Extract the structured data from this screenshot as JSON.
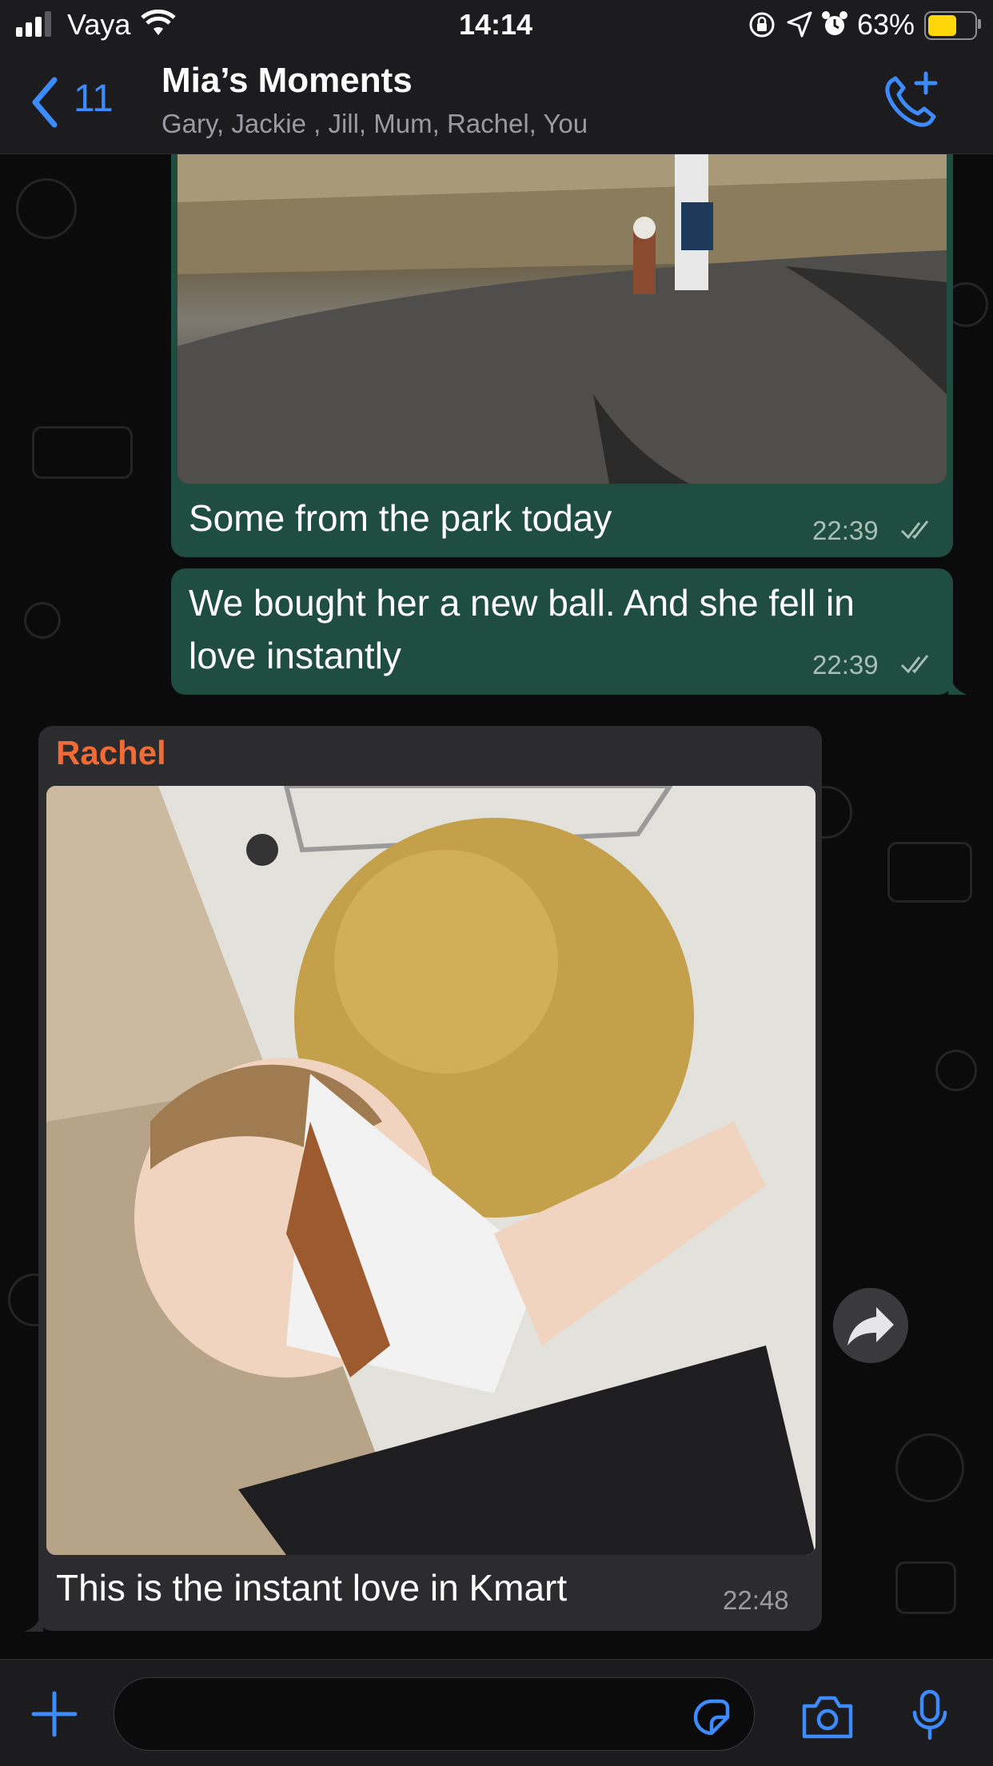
{
  "status_bar": {
    "carrier": "Vaya",
    "time": "14:14",
    "battery_percent": "63%",
    "battery_level": 0.63,
    "battery_color": "#ffd60a"
  },
  "header": {
    "back_count": "11",
    "title": "Mia’s Moments",
    "participants": "Gary, Jackie , Jill, Mum, Rachel, You",
    "accent_color": "#3d8bfd"
  },
  "messages": [
    {
      "direction": "outgoing",
      "type": "image",
      "caption": "Some from the park today",
      "time": "22:39",
      "status": "read"
    },
    {
      "direction": "outgoing",
      "type": "text",
      "text_line1": "We bought her a new ball. And she fell in",
      "text_line2": "love instantly",
      "time": "22:39",
      "status": "read"
    },
    {
      "direction": "incoming",
      "type": "image",
      "sender": "Rachel",
      "sender_color": "#f06b35",
      "caption": "This is the instant love in Kmart",
      "time": "22:48"
    }
  ],
  "icons": {
    "back": "chevron-left-icon",
    "call": "add-call-icon",
    "forward": "forward-icon",
    "attach": "plus-icon",
    "sticker": "sticker-icon",
    "camera": "camera-icon",
    "mic": "microphone-icon"
  },
  "colors": {
    "outgoing_bubble": "#1f4d3f",
    "incoming_bubble": "#2c2c2e",
    "background": "#0b0b0b"
  }
}
